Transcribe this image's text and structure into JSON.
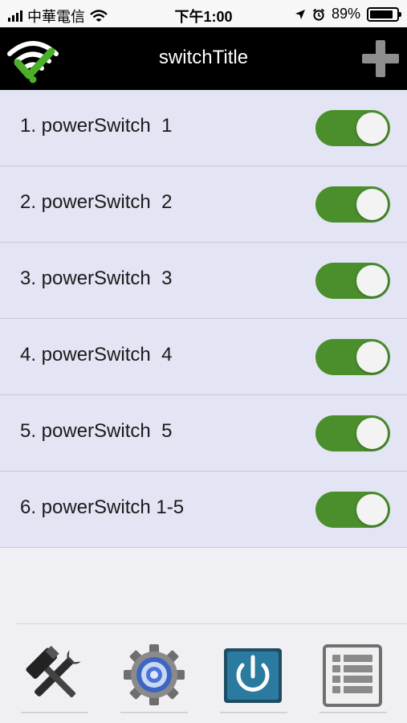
{
  "status_bar": {
    "carrier": "中華電信",
    "time": "下午1:00",
    "battery_percent": "89%",
    "battery_level": 0.89,
    "icons": [
      "signal-icon",
      "wifi-icon",
      "location-icon",
      "alarm-icon",
      "battery-icon"
    ]
  },
  "header": {
    "title": "switchTitle",
    "left_icon": "wifi-check-logo-icon",
    "right_icon": "plus-icon"
  },
  "switches": [
    {
      "label": "1. powerSwitch  1",
      "on": true
    },
    {
      "label": "2. powerSwitch  2",
      "on": true
    },
    {
      "label": "3. powerSwitch  3",
      "on": true
    },
    {
      "label": "4. powerSwitch  4",
      "on": true
    },
    {
      "label": "5. powerSwitch  5",
      "on": true
    },
    {
      "label": "6. powerSwitch 1-5",
      "on": true
    }
  ],
  "tabs": [
    {
      "icon": "tools-icon"
    },
    {
      "icon": "gear-icon"
    },
    {
      "icon": "power-icon"
    },
    {
      "icon": "list-icon"
    }
  ],
  "colors": {
    "header_bg": "#000000",
    "row_bg": "#e3e4f4",
    "toggle_on": "#4a8f2c",
    "logo_green": "#4caf29"
  }
}
